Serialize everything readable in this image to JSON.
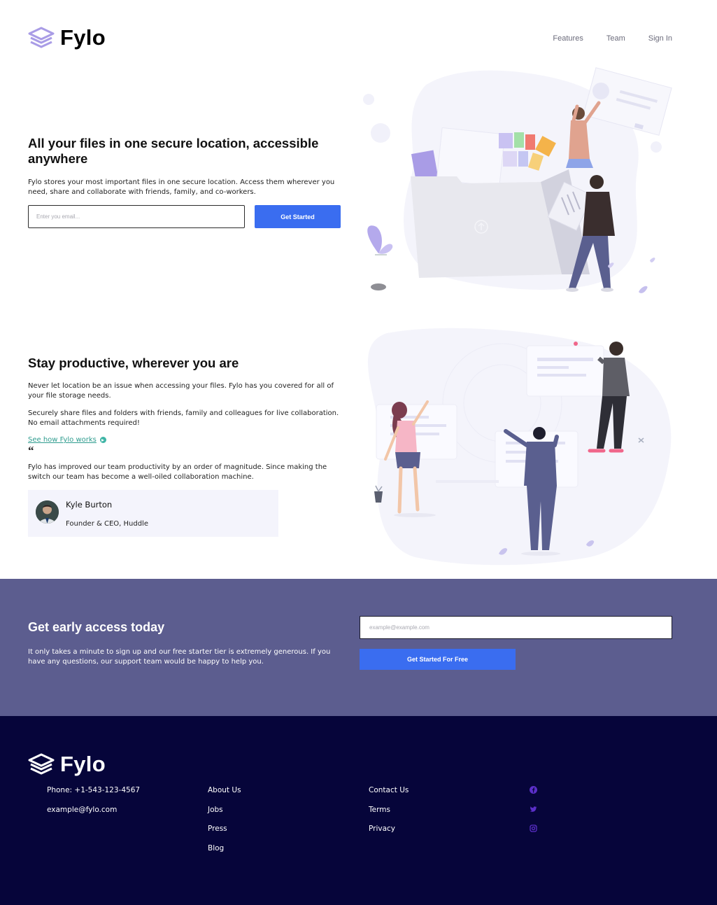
{
  "brand": {
    "name": "Fylo"
  },
  "nav": {
    "items": [
      "Features",
      "Team",
      "Sign In"
    ]
  },
  "hero": {
    "title": "All your files in one secure location, accessible anywhere",
    "description": "Fylo stores your most important files in one secure location. Access them wherever you need, share and collaborate with friends, family, and co-workers.",
    "email_placeholder": "Enter you email...",
    "button_label": "Get Started"
  },
  "productive": {
    "title": "Stay productive, wherever you are",
    "p1": "Never let location be an issue when accessing your files. Fylo has you covered for all of your file storage needs.",
    "p2": "Securely share files and folders with friends, family and colleagues for live collaboration. No email attachments required!",
    "link_label": "See how Fylo works",
    "quote_mark": "“",
    "quote": "Fylo has improved our team productivity by an order of magnitude. Since making the switch our team has become a well-oiled collaboration machine.",
    "author_name": "Kyle Burton",
    "author_role": "Founder & CEO, Huddle"
  },
  "cta": {
    "title": "Get early access today",
    "description": "It only takes a minute to sign up and our free starter tier is extremely generous. If you have any questions, our support team would be happy to help you.",
    "email_placeholder": "example@example.com",
    "button_label": "Get Started For Free"
  },
  "footer": {
    "contact": [
      "Phone: +1-543-123-4567",
      "example@fylo.com"
    ],
    "links_col1": [
      "About Us",
      "Jobs",
      "Press",
      "Blog"
    ],
    "links_col2": [
      "Contact Us",
      "Terms",
      "Privacy"
    ],
    "social_icons": [
      "facebook-icon",
      "twitter-icon",
      "instagram-icon"
    ]
  },
  "colors": {
    "accent": "#3a6df0",
    "cta_band": "#5c5d8f",
    "footer_bg": "#06053a",
    "link_teal": "#2e9c8e",
    "social": "#5b2fc9"
  }
}
